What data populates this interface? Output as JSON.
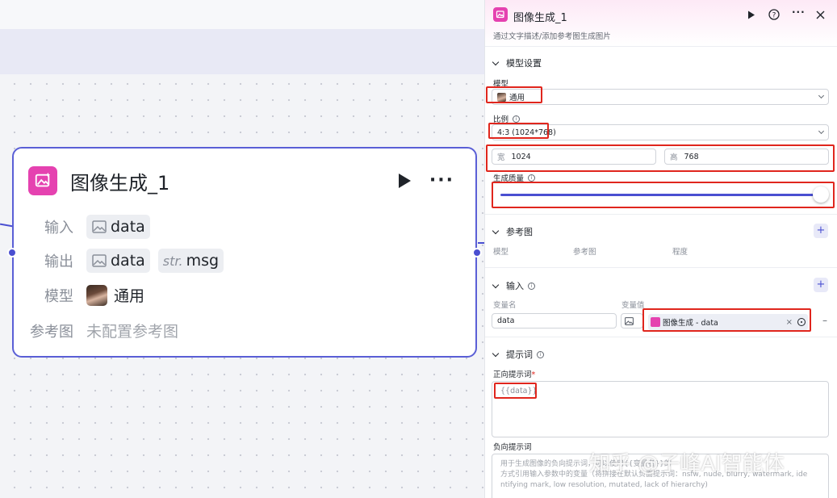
{
  "node": {
    "title": "图像生成_1",
    "input_label": "输入",
    "input_var": "data",
    "output_label": "输出",
    "output_var1": "data",
    "output_str_prefix": "str.",
    "output_var2": "msg",
    "model_label": "模型",
    "model_value": "通用",
    "ref_label": "参考图",
    "ref_value": "未配置参考图"
  },
  "panel": {
    "title": "图像生成_1",
    "description": "通过文字描述/添加参考图生成图片",
    "model_section": {
      "title": "模型设置",
      "model_label": "模型",
      "model_value": "通用",
      "ratio_label": "比例",
      "ratio_value": "4:3 (1024*768)",
      "width_prefix": "宽",
      "width_value": "1024",
      "height_prefix": "高",
      "height_value": "768",
      "quality_label": "生成质量",
      "quality_level": 1.0
    },
    "ref_section": {
      "title": "参考图",
      "col_model": "模型",
      "col_ref": "参考图",
      "col_degree": "程度"
    },
    "input_section": {
      "title": "输入",
      "col_name": "变量名",
      "col_value": "变量值",
      "var_name": "data",
      "var_value": "图像生成 - data"
    },
    "prompt_section": {
      "title": "提示词",
      "positive_label": "正向提示词",
      "required_mark": "*",
      "positive_value": "{{data}}",
      "negative_label": "负向提示词",
      "negative_placeholder_1": "用于生成图像的负向提示词，可以使用{{变量名}}的",
      "negative_placeholder_2": "方式引用输入参数中的变量（将拼接在默认负面提示词：nsfw, nude, blurry, watermark, ide",
      "negative_placeholder_3": "ntifying mark, low resolution, mutated, lack of hierarchy)"
    }
  },
  "watermark": "知乎 @子峰AI智能体",
  "colors": {
    "accent": "#4a4fd1",
    "node_icon": "#e542b0",
    "highlight": "#e0261d"
  }
}
